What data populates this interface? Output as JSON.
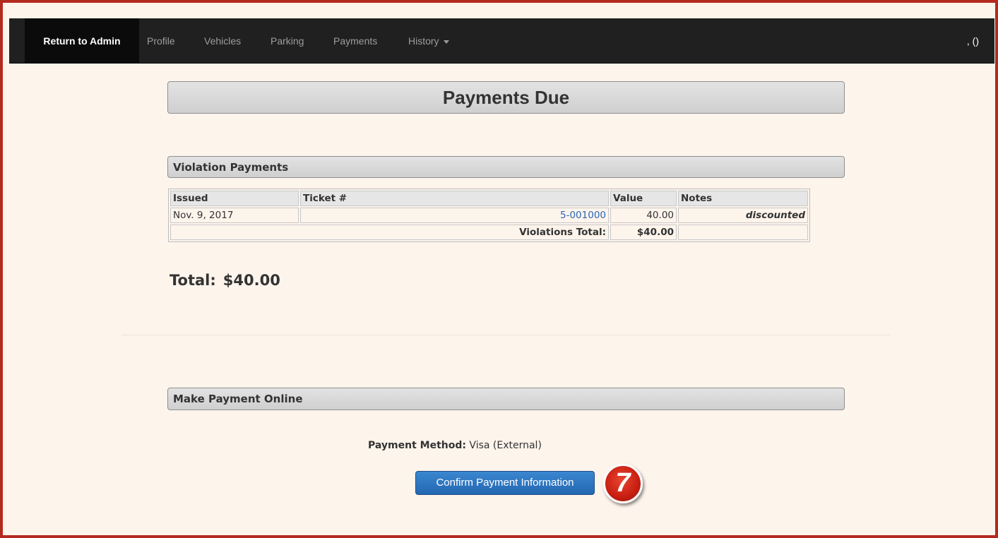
{
  "navbar": {
    "active_label": "Return to Admin",
    "items": [
      {
        "label": "Profile"
      },
      {
        "label": "Vehicles"
      },
      {
        "label": "Parking"
      },
      {
        "label": "Payments"
      },
      {
        "label": "History"
      }
    ],
    "user_text": ", ()"
  },
  "page": {
    "title": "Payments Due"
  },
  "violations": {
    "heading": "Violation Payments",
    "columns": [
      "Issued",
      "Ticket #",
      "Value",
      "Notes"
    ],
    "rows": [
      {
        "issued": "Nov. 9, 2017",
        "ticket": "5-001000",
        "value": "40.00",
        "notes": "discounted"
      }
    ],
    "total_label": "Violations Total:",
    "total_value": "$40.00"
  },
  "total": {
    "label": "Total:",
    "value": "$40.00"
  },
  "payment": {
    "heading": "Make Payment Online",
    "method_label": "Payment Method:",
    "method_value": "Visa (External)",
    "confirm_label": "Confirm Payment Information",
    "step_number": "7"
  },
  "colors": {
    "frame_border": "#b52a1f",
    "page_background": "#fdf4ec",
    "navbar_background": "#202020",
    "link": "#2a66b3",
    "primary_button": "#2a6db5",
    "step_badge": "#c81e12"
  }
}
